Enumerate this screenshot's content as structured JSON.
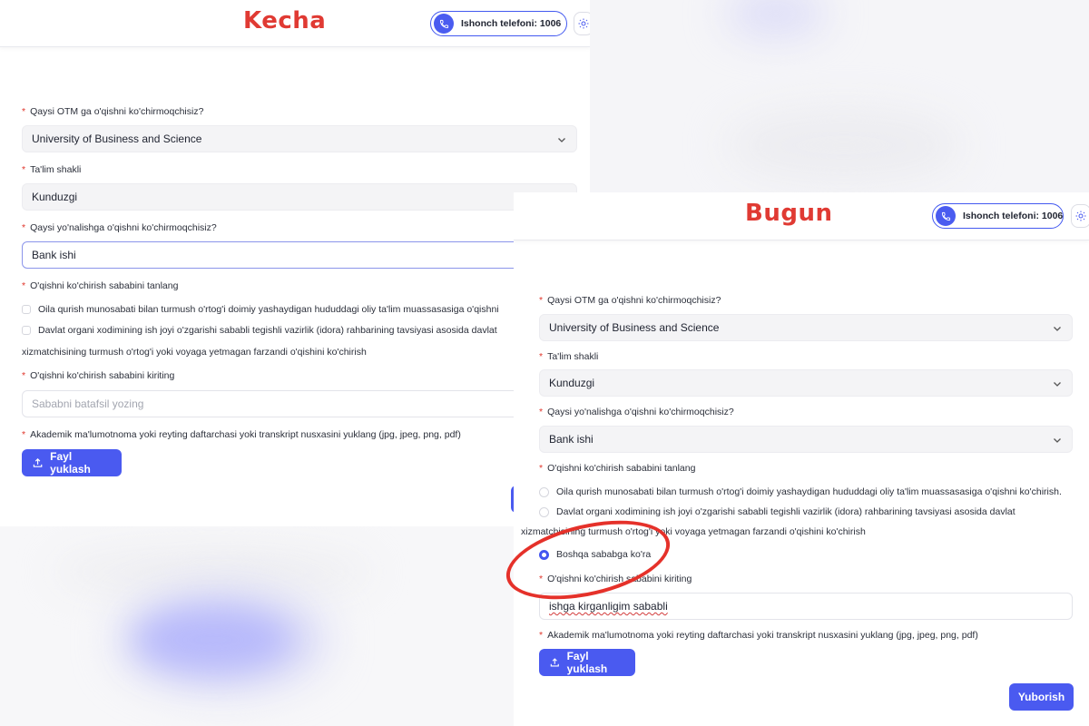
{
  "left_panel": {
    "heading": "Kecha",
    "hotline_label": "Ishonch telefoni: 1006",
    "q_otm_label": "Qaysi OTM ga o'qishni ko'chirmoqchisiz?",
    "q_otm_value": "University of Business and Science",
    "q_shakl_label": "Ta'lim shakli",
    "q_shakl_value": "Kunduzgi",
    "q_yonalish_label": "Qaysi yo'nalishga o'qishni ko'chirmoqchisiz?",
    "q_yonalish_value": "Bank ishi",
    "reason_select_label": "O'qishni ko'chirish sababini tanlang",
    "option1": "Oila qurish munosabati bilan turmush o'rtog'i doimiy yashaydigan hududdagi oliy ta'lim muassasasiga o'qishni",
    "option2_line1": "Davlat organi xodimining ish joyi o'zgarishi sababli tegishli vazirlik (idora) rahbarining tavsiyasi asosida davlat",
    "option2_line2": "xizmatchisining turmush o'rtog'i yoki voyaga yetmagan farzandi o'qishini ko'chirish",
    "reason_input_label": "O'qishni ko'chirish sababini kiriting",
    "reason_placeholder": "Sababni batafsil yozing",
    "upload_label": "Akademik ma'lumotnoma yoki reyting daftarchasi yoki transkript nusxasini yuklang (jpg, jpeg, png, pdf)",
    "upload_button": "Fayl yuklash"
  },
  "right_panel": {
    "heading": "Bugun",
    "hotline_label": "Ishonch telefoni: 1006",
    "q_otm_label": "Qaysi OTM ga o'qishni ko'chirmoqchisiz?",
    "q_otm_value": "University of Business and Science",
    "q_shakl_label": "Ta'lim shakli",
    "q_shakl_value": "Kunduzgi",
    "q_yonalish_label": "Qaysi yo'nalishga o'qishni ko'chirmoqchisiz?",
    "q_yonalish_value": "Bank ishi",
    "reason_select_label": "O'qishni ko'chirish sababini tanlang",
    "option1": "Oila qurish munosabati bilan turmush o'rtog'i doimiy yashaydigan hududdagi oliy ta'lim muassasasiga o'qishni ko'chirish.",
    "option2_line1": "Davlat organi xodimining ish joyi o'zgarishi sababli tegishli vazirlik (idora) rahbarining tavsiyasi asosida davlat",
    "option2_line2": "xizmatchisining turmush o'rtog'i yoki voyaga yetmagan farzandi o'qishini ko'chirish",
    "option3": "Boshqa sababga ko'ra",
    "option3_selected": true,
    "reason_input_label": "O'qishni ko'chirish sababini kiriting",
    "reason_value": "ishga kirganligim sababli",
    "upload_label": "Akademik ma'lumotnoma yoki reyting daftarchasi yoki transkript nusxasini yuklang (jpg, jpeg, png, pdf)",
    "upload_button": "Fayl yuklash",
    "submit_button": "Yuborish"
  },
  "colors": {
    "heading_red": "#e03a33",
    "accent_blue": "#4a5af0",
    "annotation_red": "#e5312a"
  },
  "icons": [
    "phone-icon",
    "sun-icon",
    "chevron-down-icon",
    "upload-icon"
  ]
}
